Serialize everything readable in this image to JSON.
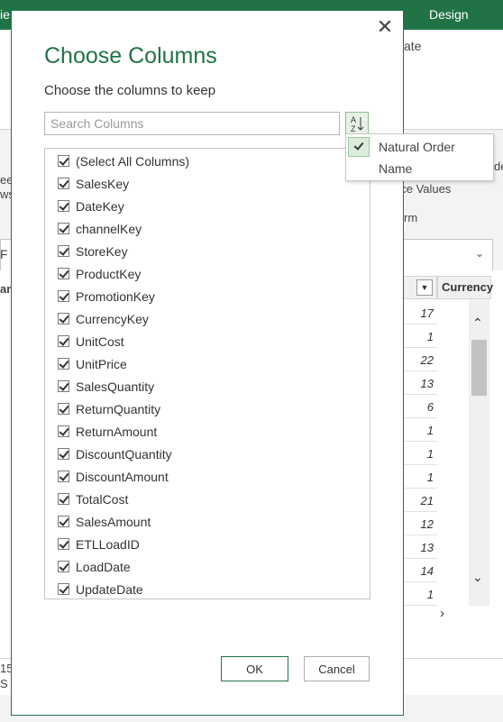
{
  "background": {
    "ribbon_tab_partial": "ie",
    "ribbon_tab_design": "Design",
    "ribbon_text_ate": "ate",
    "ribbon_text_replace": "ace Values",
    "ribbon_text_form": "rm",
    "ribbon_text_de": "de",
    "ribbon_text_ee": "ee",
    "ribbon_text_ws": "ws",
    "left_text_f": "F",
    "left_text_an": "an",
    "column_header_currency": "Currency",
    "row_values": [
      "17",
      "1",
      "22",
      "13",
      "6",
      "1",
      "1",
      "1",
      "21",
      "12",
      "13",
      "14",
      "1"
    ],
    "status_left_1": "15",
    "status_left_2": "S"
  },
  "dialog": {
    "title": "Choose Columns",
    "subtitle": "Choose the columns to keep",
    "search_placeholder": "Search Columns",
    "columns": [
      "(Select All Columns)",
      "SalesKey",
      "DateKey",
      "channelKey",
      "StoreKey",
      "ProductKey",
      "PromotionKey",
      "CurrencyKey",
      "UnitCost",
      "UnitPrice",
      "SalesQuantity",
      "ReturnQuantity",
      "ReturnAmount",
      "DiscountQuantity",
      "DiscountAmount",
      "TotalCost",
      "SalesAmount",
      "ETLLoadID",
      "LoadDate",
      "UpdateDate"
    ],
    "ok_label": "OK",
    "cancel_label": "Cancel"
  },
  "sort_menu": {
    "items": [
      {
        "label": "Natural Order",
        "checked": true
      },
      {
        "label": "Name",
        "checked": false
      }
    ]
  },
  "colors": {
    "accent": "#217346"
  }
}
